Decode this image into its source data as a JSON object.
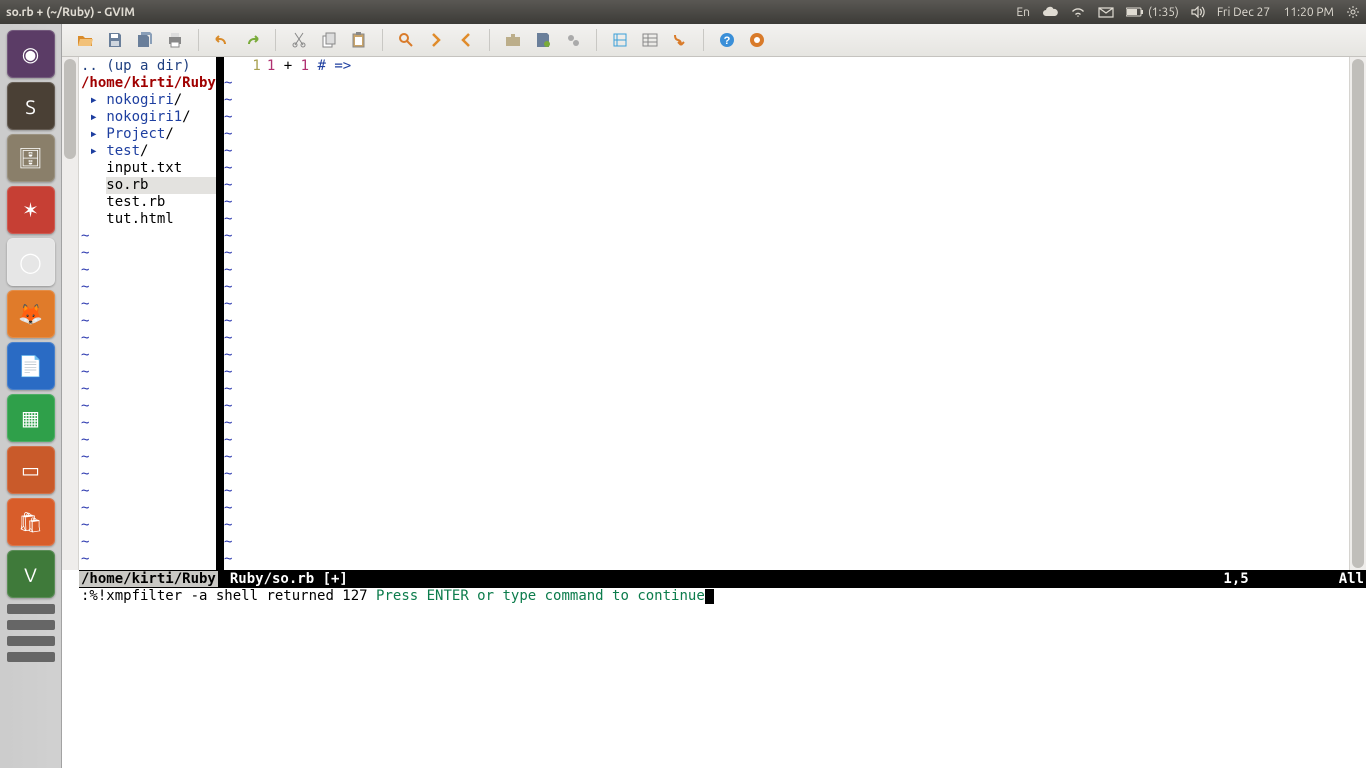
{
  "panel": {
    "title": "so.rb + (~/Ruby) - GVIM",
    "lang": "En",
    "battery": "(1:35)",
    "date": "Fri Dec 27",
    "time": "11:20 PM"
  },
  "launcher_items": [
    {
      "name": "dash",
      "color": "#5b3c66",
      "glyph": "◉"
    },
    {
      "name": "sublime",
      "color": "#4a4035",
      "glyph": "S"
    },
    {
      "name": "files",
      "color": "#8a7f6a",
      "glyph": "🗄"
    },
    {
      "name": "app-red",
      "color": "#c63f34",
      "glyph": "✶"
    },
    {
      "name": "chromium",
      "color": "#e6e6e6",
      "glyph": "◯"
    },
    {
      "name": "firefox",
      "color": "#e07b2a",
      "glyph": "🦊"
    },
    {
      "name": "writer",
      "color": "#2a6bc4",
      "glyph": "📄"
    },
    {
      "name": "calc",
      "color": "#2fa04a",
      "glyph": "▦"
    },
    {
      "name": "impress",
      "color": "#c95a2a",
      "glyph": "▭"
    },
    {
      "name": "software",
      "color": "#d85d2a",
      "glyph": "🛍"
    },
    {
      "name": "gvim",
      "color": "#3f7a3a",
      "glyph": "V"
    }
  ],
  "netrw": {
    "updir": ".. (up a dir)",
    "path": "/home/kirti/Ruby/",
    "dirs": [
      "nokogiri/",
      "nokogiri1/",
      "Project/",
      "test/"
    ],
    "files": [
      "input.txt",
      "so.rb",
      "test.rb",
      "tut.html"
    ],
    "selected": "so.rb"
  },
  "code": {
    "line_no": "1",
    "text_a": "1",
    "text_op": " + ",
    "text_b": "1",
    "comment": " # =>"
  },
  "statusline": {
    "left_path": "/home/kirti/Ruby",
    "file": "Ruby/so.rb [+]",
    "pos": "1,5",
    "scroll": "All"
  },
  "cmd": {
    "line1": ":%!xmpfilter -a",
    "line2": "shell returned 127",
    "prompt": "Press ENTER or type command to continue"
  }
}
